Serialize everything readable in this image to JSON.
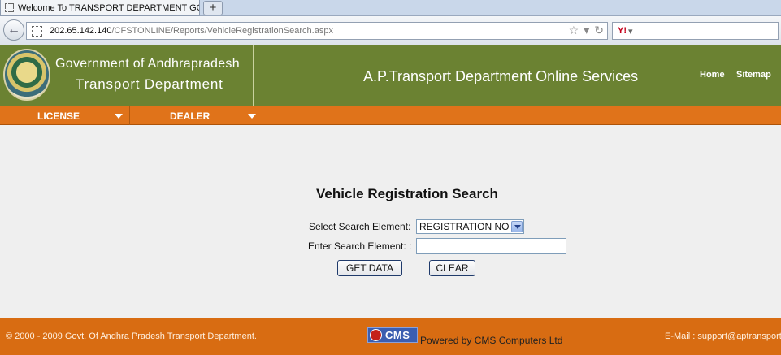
{
  "browser": {
    "tab_title": "Welcome To TRANSPORT DEPARTMENT GOV...",
    "new_tab": "+",
    "url_host": "202.65.142.140",
    "url_path": "/CFSTONLINE/Reports/VehicleRegistrationSearch.aspx",
    "search_engine_label": "Y!"
  },
  "header": {
    "gov_name": "Government of Andhrapradesh",
    "dept_name": "Transport Department",
    "site_title": "A.P.Transport Department Online Services",
    "links": {
      "home": "Home",
      "sitemap": "Sitemap"
    }
  },
  "menu": {
    "items": [
      {
        "label": "LICENSE"
      },
      {
        "label": "DEALER"
      }
    ]
  },
  "search": {
    "title": "Vehicle Registration Search",
    "select_label": "Select Search Element:",
    "selected_value": "REGISTRATION NO",
    "input_label": "Enter Search Element: :",
    "input_value": "",
    "get_data_label": "GET DATA",
    "clear_label": "CLEAR"
  },
  "footer": {
    "copyright": "© 2000 - 2009 Govt. Of Andhra Pradesh Transport Department.",
    "cms_logo_text": "CMS",
    "powered_by": "Powered by CMS Computers Ltd",
    "email": "E-Mail : support@aptransport"
  },
  "colors": {
    "header_green": "#6b8232",
    "menu_orange": "#e0731a",
    "footer_orange": "#d86c12",
    "page_bg": "#efefef"
  }
}
